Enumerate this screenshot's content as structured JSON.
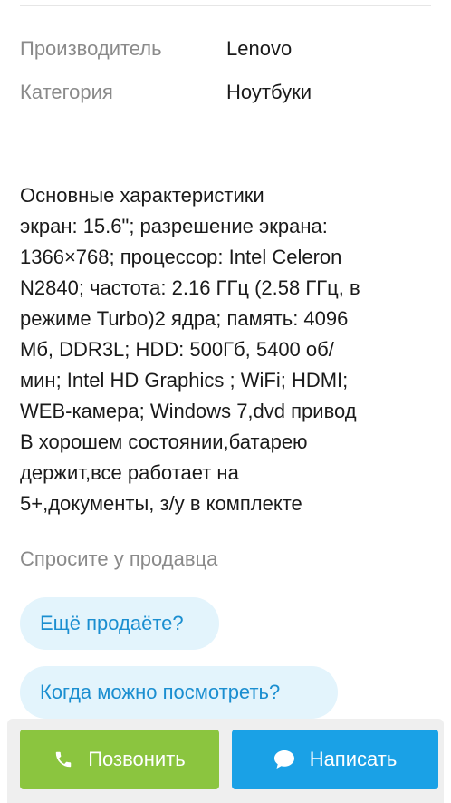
{
  "specs": [
    {
      "label": "Производитель",
      "value": "Lenovo"
    },
    {
      "label": "Категория",
      "value": "Ноутбуки"
    }
  ],
  "description": {
    "lines": [
      "Основные характеристики",
      "экран: 15.6\"; разрешение экрана:",
      "1366×768; процессор: Intel Celeron",
      "N2840; частота: 2.16 ГГц (2.58 ГГц, в",
      "режиме Turbo)2 ядра; память: 4096",
      "Мб, DDR3L; HDD: 500Гб, 5400 об/",
      "мин; Intel HD Graphics ; WiFi; HDMI;",
      "WEB-камера; Windows 7,dvd привод",
      "В хорошем состоянии,батарею",
      "держит,все работает на",
      "5+,документы, з/у в комплекте"
    ]
  },
  "ask_seller": {
    "title": "Спросите у продавца",
    "questions": [
      "Ещё продаёте?",
      "Когда можно посмотреть?"
    ]
  },
  "actions": {
    "call_label": "Позвонить",
    "write_label": "Написать"
  },
  "colors": {
    "call_button": "#8bc53f",
    "write_button": "#1aa1e6",
    "chip_background": "#e3f4fc",
    "chip_text": "#1a8ed0"
  },
  "icons": {
    "call": "phone-icon",
    "write": "chat-bubble-icon"
  }
}
